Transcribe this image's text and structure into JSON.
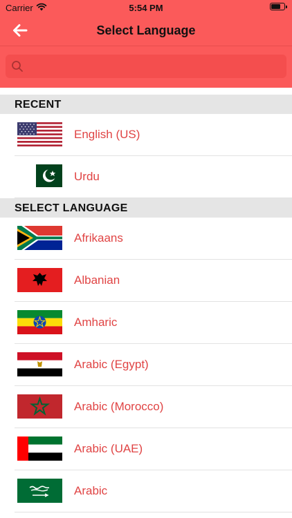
{
  "status": {
    "carrier": "Carrier",
    "time": "5:54 PM"
  },
  "nav": {
    "title": "Select Language"
  },
  "search": {
    "placeholder": ""
  },
  "recent": {
    "header": "RECENT",
    "items": [
      {
        "label": "English (US)",
        "flag": "us-flag-icon"
      },
      {
        "label": "Urdu",
        "flag": "pakistan-flag-icon"
      }
    ]
  },
  "languages": {
    "header": "SELECT LANGUAGE",
    "items": [
      {
        "label": "Afrikaans",
        "flag": "south-africa-flag-icon"
      },
      {
        "label": "Albanian",
        "flag": "albania-flag-icon"
      },
      {
        "label": "Amharic",
        "flag": "ethiopia-flag-icon"
      },
      {
        "label": "Arabic (Egypt)",
        "flag": "egypt-flag-icon"
      },
      {
        "label": "Arabic (Morocco)",
        "flag": "morocco-flag-icon"
      },
      {
        "label": "Arabic (UAE)",
        "flag": "uae-flag-icon"
      },
      {
        "label": "Arabic",
        "flag": "saudi-arabia-flag-icon"
      }
    ]
  },
  "colors": {
    "accent": "#fb5a5a",
    "label": "#e04444",
    "section_bg": "#e5e5e5"
  }
}
